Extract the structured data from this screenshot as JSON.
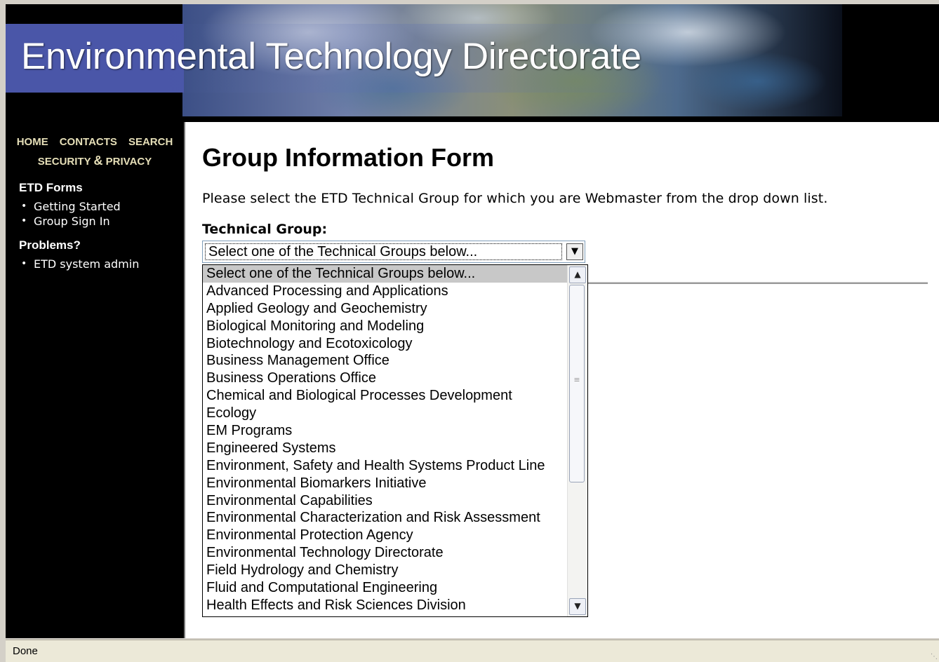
{
  "banner": {
    "title": "Environmental Technology Directorate"
  },
  "nav": {
    "home": "HOME",
    "contacts": "CONTACTS",
    "search": "SEARCH",
    "security": "SECURITY",
    "amp": "&",
    "privacy": "PRIVACY"
  },
  "sidebar": {
    "etd_forms_heading": "ETD Forms",
    "etd_forms_links": [
      "Getting Started",
      "Group Sign In"
    ],
    "problems_heading": "Problems?",
    "problems_links": [
      "ETD system admin"
    ]
  },
  "main": {
    "title": "Group Information Form",
    "instructions": "Please select the ETD Technical Group for which you are Webmaster from the drop down list.",
    "group_label": "Technical Group:",
    "select_value": "Select one of the Technical Groups below...",
    "options": [
      "Select one of the Technical Groups below...",
      "Advanced Processing and Applications",
      "Applied Geology and Geochemistry",
      "Biological Monitoring and Modeling",
      "Biotechnology and Ecotoxicology",
      "Business Management Office",
      "Business Operations Office",
      "Chemical and Biological Processes Development",
      "Ecology",
      "EM Programs",
      "Engineered Systems",
      "Environment, Safety and Health Systems Product Line",
      "Environmental Biomarkers Initiative",
      "Environmental Capabilities",
      "Environmental Characterization and Risk Assessment",
      "Environmental Protection Agency",
      "Environmental Technology Directorate",
      "Field Hydrology and Chemistry",
      "Fluid and Computational Engineering",
      "Health Effects and Risk Sciences Division"
    ],
    "selected_index": 0
  },
  "status_bar": {
    "text": "Done"
  },
  "icons": {
    "select_arrow": "chevron-down-icon",
    "scroll_up": "chevron-up-icon",
    "scroll_down": "chevron-down-icon"
  },
  "colors": {
    "banner_band": "#4a56a8",
    "nav_text": "#e6dfb8",
    "selected_option": "#c8c8c8"
  }
}
